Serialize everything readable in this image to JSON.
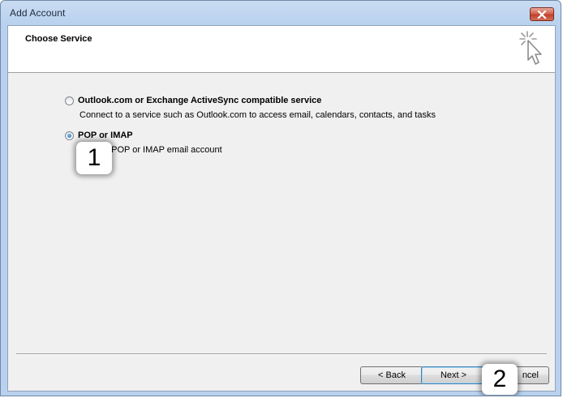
{
  "window": {
    "title": "Add Account"
  },
  "header": {
    "title": "Choose Service"
  },
  "options": [
    {
      "label": "Outlook.com or Exchange ActiveSync compatible service",
      "description": "Connect to a service such as Outlook.com to access email, calendars, contacts, and tasks",
      "selected": false
    },
    {
      "label": "POP or IMAP",
      "description": "ect to a POP or IMAP email account",
      "selected": true
    }
  ],
  "callouts": {
    "first": "1",
    "second": "2"
  },
  "buttons": {
    "back": "< Back",
    "next": "Next >",
    "cancel": "ncel"
  },
  "icons": {
    "close": "close-icon",
    "wizard": "wizard-cursor-icon"
  },
  "colors": {
    "window_frame": "#b9d1ee",
    "close_button": "#c0402b",
    "dialog_background": "#f0f0f0",
    "radio_selected": "#1a5fa8"
  }
}
